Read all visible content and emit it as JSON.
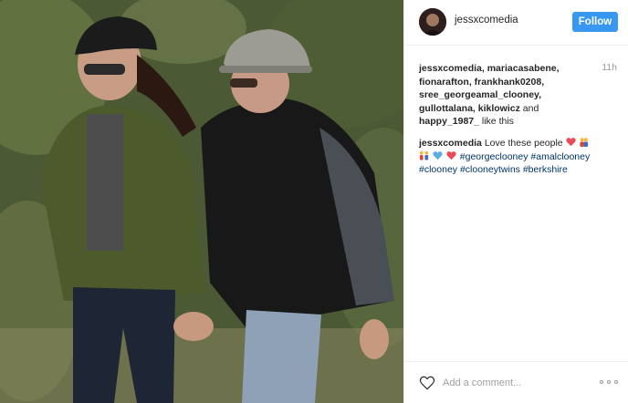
{
  "post": {
    "username": "jessxcomedia",
    "follow_label": "Follow",
    "time": "11h",
    "likes": {
      "names": "jessxcomedia, mariacasabene, fionarafton, frankhank0208, sree_georgeamal_clooney, gullottalana, kiklowicz",
      "and": "and",
      "last": "happy_1987_",
      "suffix": "like this"
    },
    "caption": {
      "author": "jessxcomedia",
      "text": "Love these people",
      "hashtags": [
        "#georgeclooney",
        "#amalclooney",
        "#clooney",
        "#clooneytwins",
        "#berkshire"
      ]
    },
    "comment_placeholder": "Add a comment...",
    "icons": {
      "like": "heart-icon",
      "more": "more-options-icon",
      "emoji": [
        "red-heart-emoji",
        "couple-emoji",
        "family-emoji",
        "blue-heart-emoji",
        "red-heart-emoji"
      ]
    },
    "colors": {
      "follow": "#3897f0",
      "hashtag": "#003569",
      "heart": "#ed4956",
      "blue_heart": "#5dade2"
    }
  }
}
